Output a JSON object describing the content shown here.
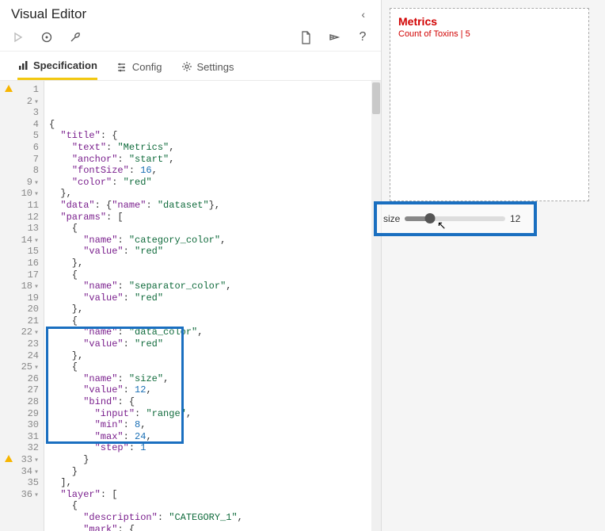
{
  "header": {
    "title": "Visual Editor"
  },
  "toolbar": {
    "play": "▷",
    "refresh": "↻",
    "wrench": "🔧",
    "newfile": "📄",
    "share": "Share",
    "help": "?"
  },
  "tabs": {
    "specification": "Specification",
    "config": "Config",
    "settings": "Settings"
  },
  "gutter": {
    "warn_lines": [
      1,
      33
    ],
    "fold_lines": [
      2,
      9,
      10,
      14,
      18,
      22,
      25,
      33,
      34,
      36
    ],
    "count": 36
  },
  "code_lines": [
    {
      "raw": "{",
      "segs": [
        [
          "p",
          "{"
        ]
      ]
    },
    {
      "raw": "  \"title\": {",
      "segs": [
        [
          "p",
          "  "
        ],
        [
          "k",
          "\"title\""
        ],
        [
          "p",
          ": {"
        ]
      ]
    },
    {
      "raw": "    \"text\": \"Metrics\",",
      "segs": [
        [
          "p",
          "    "
        ],
        [
          "k",
          "\"text\""
        ],
        [
          "p",
          ": "
        ],
        [
          "s",
          "\"Metrics\""
        ],
        [
          "p",
          ","
        ]
      ]
    },
    {
      "raw": "    \"anchor\": \"start\",",
      "segs": [
        [
          "p",
          "    "
        ],
        [
          "k",
          "\"anchor\""
        ],
        [
          "p",
          ": "
        ],
        [
          "s",
          "\"start\""
        ],
        [
          "p",
          ","
        ]
      ]
    },
    {
      "raw": "    \"fontSize\": 16,",
      "segs": [
        [
          "p",
          "    "
        ],
        [
          "k",
          "\"fontSize\""
        ],
        [
          "p",
          ": "
        ],
        [
          "n",
          "16"
        ],
        [
          "p",
          ","
        ]
      ]
    },
    {
      "raw": "    \"color\": \"red\"",
      "segs": [
        [
          "p",
          "    "
        ],
        [
          "k",
          "\"color\""
        ],
        [
          "p",
          ": "
        ],
        [
          "s",
          "\"red\""
        ]
      ]
    },
    {
      "raw": "  },",
      "segs": [
        [
          "p",
          "  },"
        ]
      ]
    },
    {
      "raw": "  \"data\": {\"name\": \"dataset\"},",
      "segs": [
        [
          "p",
          "  "
        ],
        [
          "k",
          "\"data\""
        ],
        [
          "p",
          ": {"
        ],
        [
          "k",
          "\"name\""
        ],
        [
          "p",
          ": "
        ],
        [
          "s",
          "\"dataset\""
        ],
        [
          "p",
          "},"
        ]
      ]
    },
    {
      "raw": "  \"params\": [",
      "segs": [
        [
          "p",
          "  "
        ],
        [
          "k",
          "\"params\""
        ],
        [
          "p",
          ": ["
        ]
      ]
    },
    {
      "raw": "    {",
      "segs": [
        [
          "p",
          "    {"
        ]
      ]
    },
    {
      "raw": "      \"name\": \"category_color\",",
      "segs": [
        [
          "p",
          "      "
        ],
        [
          "k",
          "\"name\""
        ],
        [
          "p",
          ": "
        ],
        [
          "s",
          "\"category_color\""
        ],
        [
          "p",
          ","
        ]
      ]
    },
    {
      "raw": "      \"value\": \"red\"",
      "segs": [
        [
          "p",
          "      "
        ],
        [
          "k",
          "\"value\""
        ],
        [
          "p",
          ": "
        ],
        [
          "s",
          "\"red\""
        ]
      ]
    },
    {
      "raw": "    },",
      "segs": [
        [
          "p",
          "    },"
        ]
      ]
    },
    {
      "raw": "    {",
      "segs": [
        [
          "p",
          "    {"
        ]
      ]
    },
    {
      "raw": "      \"name\": \"separator_color\",",
      "segs": [
        [
          "p",
          "      "
        ],
        [
          "k",
          "\"name\""
        ],
        [
          "p",
          ": "
        ],
        [
          "s",
          "\"separator_color\""
        ],
        [
          "p",
          ","
        ]
      ]
    },
    {
      "raw": "      \"value\": \"red\"",
      "segs": [
        [
          "p",
          "      "
        ],
        [
          "k",
          "\"value\""
        ],
        [
          "p",
          ": "
        ],
        [
          "s",
          "\"red\""
        ]
      ]
    },
    {
      "raw": "    },",
      "segs": [
        [
          "p",
          "    },"
        ]
      ]
    },
    {
      "raw": "    {",
      "segs": [
        [
          "p",
          "    {"
        ]
      ]
    },
    {
      "raw": "      \"name\": \"data_color\",",
      "segs": [
        [
          "p",
          "      "
        ],
        [
          "k",
          "\"name\""
        ],
        [
          "p",
          ": "
        ],
        [
          "s",
          "\"data_color\""
        ],
        [
          "p",
          ","
        ]
      ]
    },
    {
      "raw": "      \"value\": \"red\"",
      "segs": [
        [
          "p",
          "      "
        ],
        [
          "k",
          "\"value\""
        ],
        [
          "p",
          ": "
        ],
        [
          "s",
          "\"red\""
        ]
      ]
    },
    {
      "raw": "    },",
      "segs": [
        [
          "p",
          "    },"
        ]
      ]
    },
    {
      "raw": "    {",
      "segs": [
        [
          "p",
          "    {"
        ]
      ]
    },
    {
      "raw": "      \"name\": \"size\",",
      "segs": [
        [
          "p",
          "      "
        ],
        [
          "k",
          "\"name\""
        ],
        [
          "p",
          ": "
        ],
        [
          "s",
          "\"size\""
        ],
        [
          "p",
          ","
        ]
      ]
    },
    {
      "raw": "      \"value\": 12,",
      "segs": [
        [
          "p",
          "      "
        ],
        [
          "k",
          "\"value\""
        ],
        [
          "p",
          ": "
        ],
        [
          "n",
          "12"
        ],
        [
          "p",
          ","
        ]
      ]
    },
    {
      "raw": "      \"bind\": {",
      "segs": [
        [
          "p",
          "      "
        ],
        [
          "k",
          "\"bind\""
        ],
        [
          "p",
          ": {"
        ]
      ]
    },
    {
      "raw": "        \"input\": \"range\",",
      "segs": [
        [
          "p",
          "        "
        ],
        [
          "k",
          "\"input\""
        ],
        [
          "p",
          ": "
        ],
        [
          "s",
          "\"range\""
        ],
        [
          "p",
          ","
        ]
      ]
    },
    {
      "raw": "        \"min\": 8,",
      "segs": [
        [
          "p",
          "        "
        ],
        [
          "k",
          "\"min\""
        ],
        [
          "p",
          ": "
        ],
        [
          "n",
          "8"
        ],
        [
          "p",
          ","
        ]
      ]
    },
    {
      "raw": "        \"max\": 24,",
      "segs": [
        [
          "p",
          "        "
        ],
        [
          "k",
          "\"max\""
        ],
        [
          "p",
          ": "
        ],
        [
          "n",
          "24"
        ],
        [
          "p",
          ","
        ]
      ]
    },
    {
      "raw": "        \"step\": 1",
      "segs": [
        [
          "p",
          "        "
        ],
        [
          "k",
          "\"step\""
        ],
        [
          "p",
          ": "
        ],
        [
          "n",
          "1"
        ]
      ]
    },
    {
      "raw": "      }",
      "segs": [
        [
          "p",
          "      }"
        ]
      ]
    },
    {
      "raw": "    }",
      "segs": [
        [
          "p",
          "    }"
        ]
      ]
    },
    {
      "raw": "  ],",
      "segs": [
        [
          "p",
          "  ],"
        ]
      ]
    },
    {
      "raw": "  \"layer\": [",
      "segs": [
        [
          "p",
          "  "
        ],
        [
          "k",
          "\"layer\""
        ],
        [
          "p",
          ": ["
        ]
      ]
    },
    {
      "raw": "    {",
      "segs": [
        [
          "p",
          "    {"
        ]
      ]
    },
    {
      "raw": "      \"description\": \"CATEGORY_1\",",
      "segs": [
        [
          "p",
          "      "
        ],
        [
          "k",
          "\"description\""
        ],
        [
          "p",
          ": "
        ],
        [
          "s",
          "\"CATEGORY_1\""
        ],
        [
          "p",
          ","
        ]
      ]
    },
    {
      "raw": "      \"mark\": {",
      "segs": [
        [
          "p",
          "      "
        ],
        [
          "k",
          "\"mark\""
        ],
        [
          "p",
          ": {"
        ]
      ]
    }
  ],
  "viz": {
    "title": "Metrics",
    "subtitle": "Count of Toxins | 5"
  },
  "slider": {
    "label": "size",
    "value": "12"
  }
}
